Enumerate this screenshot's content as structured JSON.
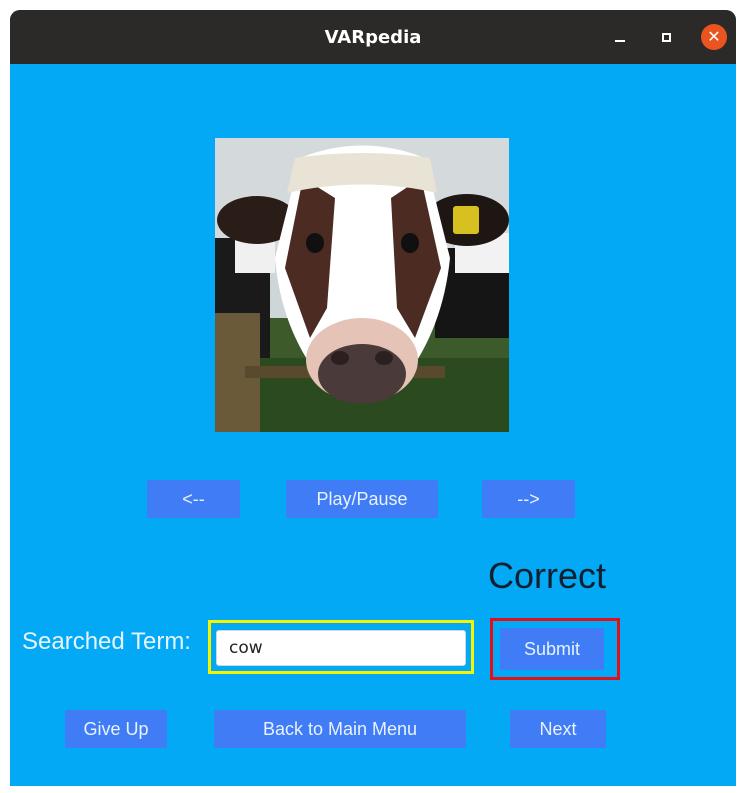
{
  "window": {
    "title": "VARpedia",
    "controls": {
      "minimize_icon": "minimize-icon",
      "maximize_icon": "maximize-icon",
      "close_icon": "close-icon",
      "close_glyph": "✕"
    }
  },
  "media": {
    "image_subject": "cow",
    "prev_label": "<--",
    "play_pause_label": "Play/Pause",
    "next_label": "-->"
  },
  "quiz": {
    "result_text": "Correct",
    "searched_term_label": "Searched Term:",
    "input_value": "cow",
    "submit_label": "Submit"
  },
  "footer": {
    "give_up_label": "Give Up",
    "back_to_main_label": "Back to Main Menu",
    "next_label": "Next"
  },
  "colors": {
    "background": "#03a9f4",
    "titlebar": "#2c2a28",
    "button": "#3f7cf5",
    "close_button": "#e95420",
    "input_highlight": "#f5f500",
    "submit_highlight": "#e0101a"
  }
}
